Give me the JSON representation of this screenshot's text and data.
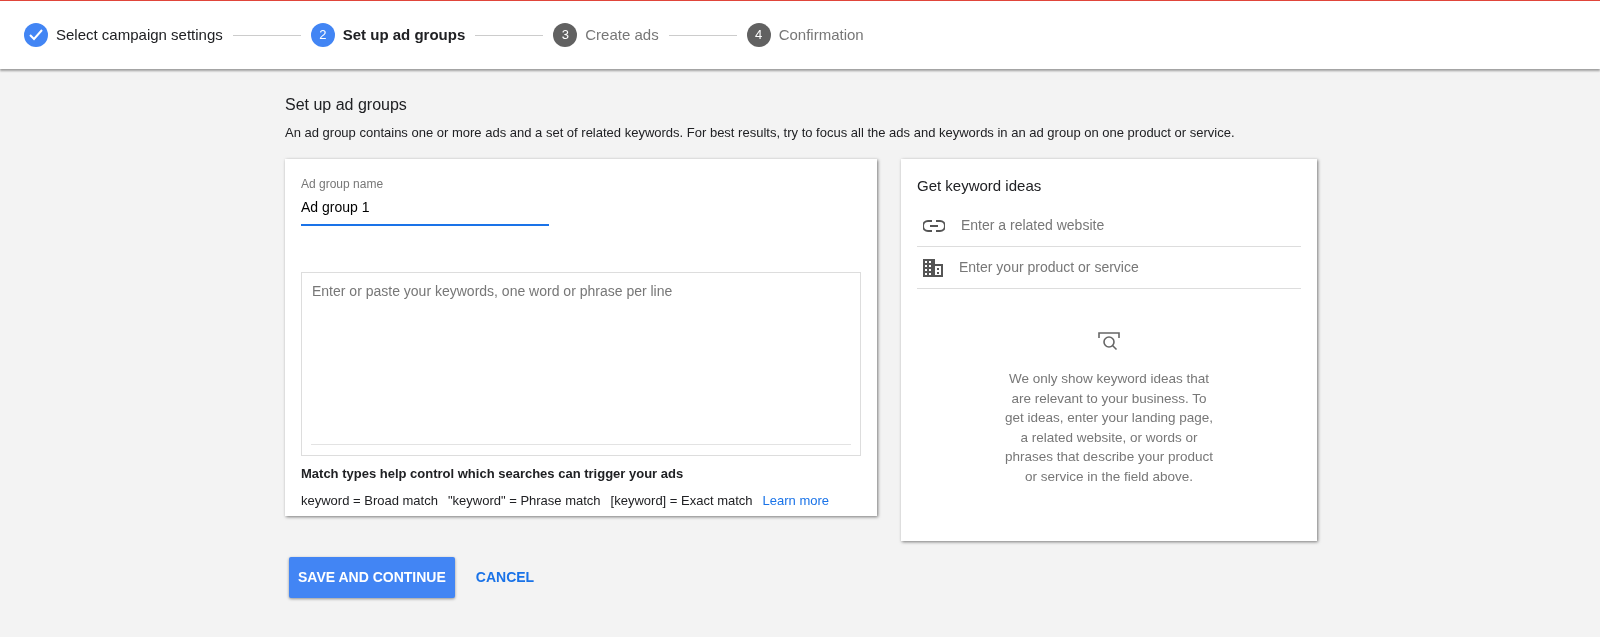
{
  "steps": [
    {
      "label": "Select campaign settings",
      "completed": true,
      "selected": false
    },
    {
      "number": "2",
      "label": "Set up ad groups",
      "completed": false,
      "selected": true
    },
    {
      "number": "3",
      "label": "Create ads",
      "completed": false,
      "selected": false
    },
    {
      "number": "4",
      "label": "Confirmation",
      "completed": false,
      "selected": false
    }
  ],
  "page": {
    "title": "Set up ad groups",
    "description": "An ad group contains one or more ads and a set of related keywords. For best results, try to focus all the ads and keywords in an ad group on one product or service."
  },
  "ad_group": {
    "label": "Ad group name",
    "value": "Ad group 1"
  },
  "keywords": {
    "placeholder": "Enter or paste your keywords, one word or phrase per line"
  },
  "match_types": {
    "heading": "Match types help control which searches can trigger your ads",
    "examples": [
      "keyword = Broad match",
      "\"keyword\" = Phrase match",
      "[keyword] = Exact match"
    ],
    "link": "Learn more"
  },
  "keyword_ideas": {
    "title": "Get keyword ideas",
    "fields": [
      {
        "kind": "website",
        "placeholder": "Enter a related website"
      },
      {
        "kind": "product",
        "placeholder": "Enter your product or service"
      }
    ],
    "message": "We only show keyword ideas that are relevant to your business. To get ideas, enter your landing page, a related website, or words or phrases that describe your product or service in the field above."
  },
  "buttons": {
    "primary": "SAVE AND CONTINUE",
    "secondary": "CANCEL"
  }
}
